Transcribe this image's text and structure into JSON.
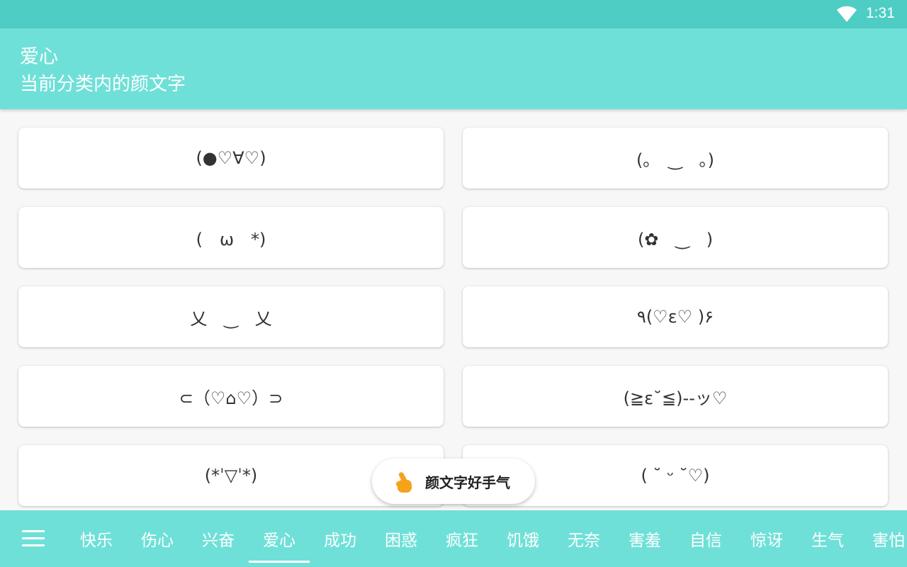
{
  "status_bar": {
    "time": "1:31"
  },
  "header": {
    "title": "爱心",
    "subtitle": "当前分类内的颜文字"
  },
  "kaomoji": [
    "(●♡∀♡)",
    "(｡　‿　｡)",
    "(　ω　*)",
    "(✿　‿　)",
    "乂　‿　乂",
    "٩(♡ε♡ )۶",
    "⊂（♡⌂♡）⊃",
    "(≧ε˘≦)--ッ♡",
    "(*ˈ▽ˈ*)",
    "( ˘ ᵕ ˘♡)"
  ],
  "fab": {
    "label": "颜文字好手气",
    "icon": "finger-heart-icon"
  },
  "nav": {
    "menu_icon": "menu-icon",
    "active_tab": "爱心",
    "tabs": [
      "快乐",
      "伤心",
      "兴奋",
      "爱心",
      "成功",
      "困惑",
      "疯狂",
      "饥饿",
      "无奈",
      "害羞",
      "自信",
      "惊讶",
      "生气",
      "害怕"
    ]
  },
  "colors": {
    "status_bar": "#4ecdc4",
    "header": "#6fe0d8",
    "nav": "#6fe0d8",
    "fab_icon": "#f7a21b"
  }
}
